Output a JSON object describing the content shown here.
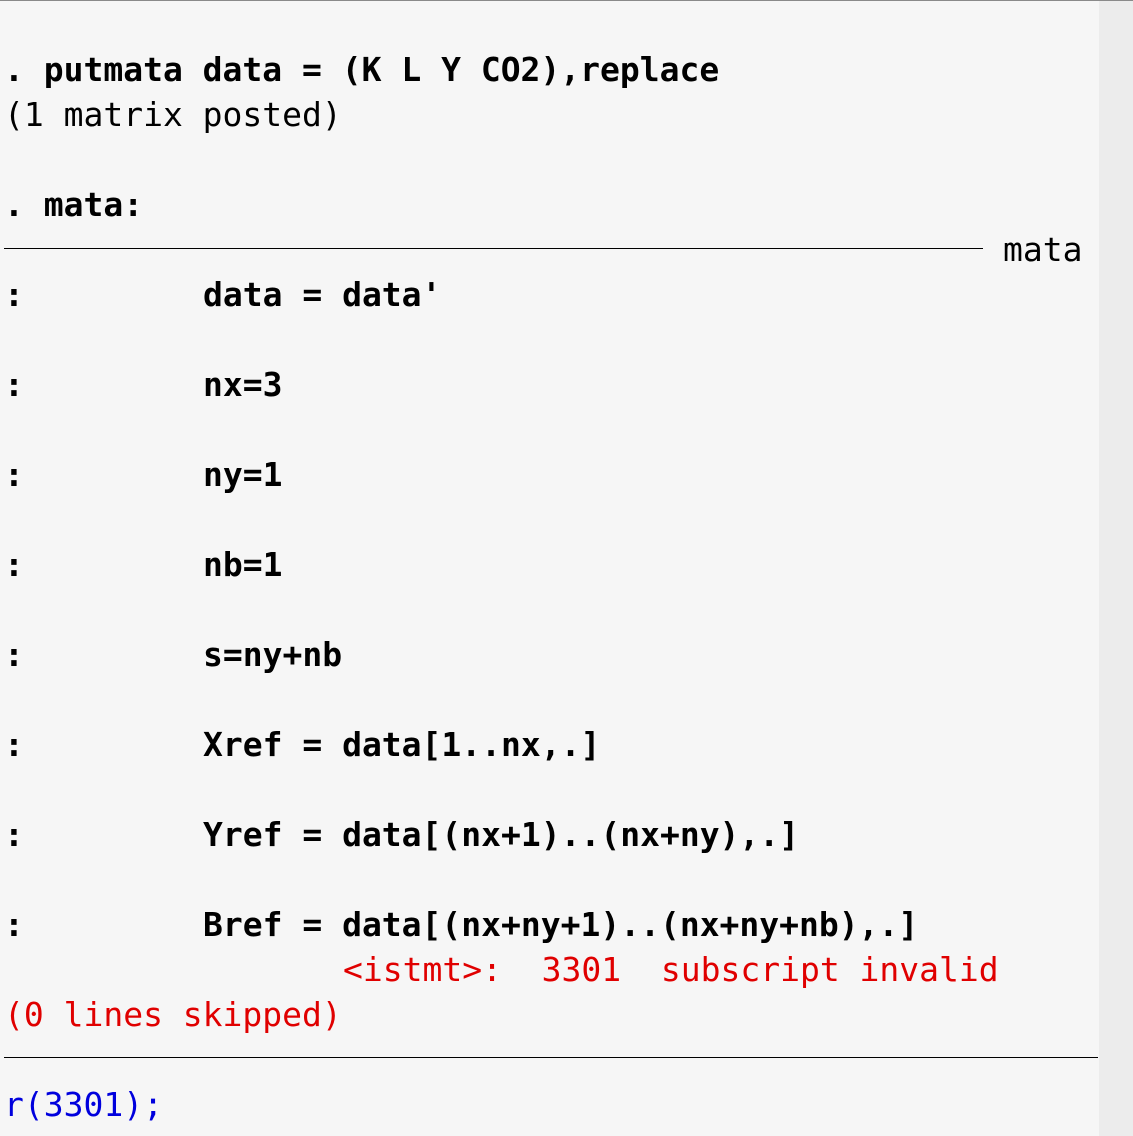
{
  "console": {
    "putmata_command": ". putmata data = (K L Y CO2),replace",
    "putmata_result": "(1 matrix posted)",
    "mata_command": ". mata:",
    "mata_section_label": "mata",
    "prompt": ":",
    "statements": [
      "data = data'",
      "nx=3",
      "ny=1",
      "nb=1",
      "s=ny+nb",
      "Xref = data[1..nx,.]",
      "Yref = data[(nx+1)..(nx+ny),.]",
      "Bref = data[(nx+ny+1)..(nx+ny+nb),.]"
    ],
    "error_message": "<istmt>:  3301  subscript invalid",
    "lines_skipped": "(0 lines skipped)",
    "return_code": "r(3301);"
  },
  "colors": {
    "background": "#f6f6f6",
    "command_text": "#000000",
    "error_text": "#e00000",
    "return_code_text": "#0000dd"
  }
}
